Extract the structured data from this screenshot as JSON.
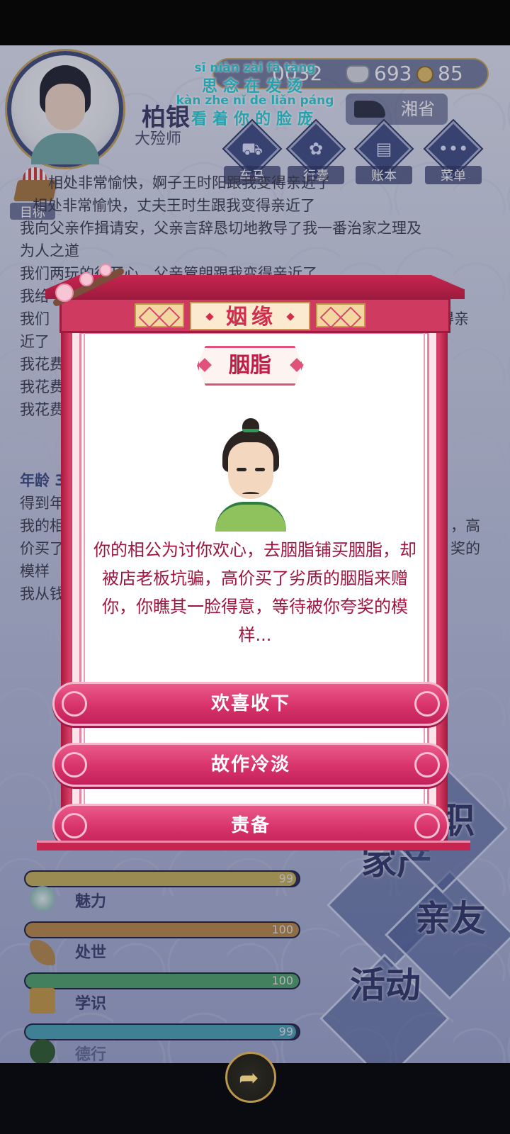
{
  "header": {
    "resources": {
      "silver_partial": "0032",
      "silver": "693",
      "gold": "85"
    },
    "lyric": {
      "pinyin_1": "sī niàn zài fā tàng",
      "line_1": "思念在发烫",
      "pinyin_2": "kàn zhe nǐ de liǎn páng",
      "line_2": "看着你的脸庞"
    },
    "player_name": "柏银",
    "player_title": "大殓师",
    "province": "湘省",
    "menu": [
      {
        "label": "车马",
        "icon": "carriage-icon",
        "glyph": "⛟"
      },
      {
        "label": "行囊",
        "icon": "bag-icon",
        "glyph": "✿"
      },
      {
        "label": "账本",
        "icon": "ledger-icon",
        "glyph": "▤"
      },
      {
        "label": "菜单",
        "icon": "more-icon",
        "glyph": "•••"
      }
    ],
    "target_label": "目标"
  },
  "log": {
    "lines_top": [
      "相处非常愉快，婀子王时阳跟我变得亲近了",
      "相处非常愉快，丈夫王时生跟我变得亲近了",
      "我向父亲作揖请安，父亲言辞恳切地教导了我一番治家之理及",
      "为人之道",
      "我们两玩的很开心，父亲管朗跟我变得亲近了",
      "我给",
      "我们",
      "近了",
      "我花费",
      "我花费",
      "我花费"
    ],
    "right_fragment_1": "得亲",
    "age_label": "年龄 3",
    "lines_bottom": [
      "得到年",
      "我的相",
      "价买了",
      "模样",
      "我从钱"
    ],
    "right_fragment_2": "，高",
    "right_fragment_3": "奖的"
  },
  "stats": [
    {
      "label": "",
      "value": 99,
      "max": 100,
      "color": "#c6b25a",
      "icon": "body-icon"
    },
    {
      "label": "魅力",
      "value": 100,
      "max": 100,
      "color": "#b88a48",
      "icon": "charm-icon"
    },
    {
      "label": "处世",
      "value": 100,
      "max": 100,
      "color": "#4ea36a",
      "icon": "worldly-icon"
    },
    {
      "label": "学识",
      "value": 99,
      "max": 100,
      "color": "#4aa3b6",
      "icon": "knowledge-icon"
    },
    {
      "label": "德行",
      "value": 100,
      "max": 100,
      "color": "#6b3a4a",
      "icon": "virtue-icon"
    }
  ],
  "side_tiles": {
    "family_property": "家产",
    "relatives": "亲友",
    "activity": "活动",
    "partial": "职"
  },
  "modal": {
    "title": "姻缘",
    "subtitle": "胭脂",
    "story": "你的相公为讨你欢心，去胭脂铺买胭脂，却被店老板坑骗，高价买了劣质的胭脂来赠你，你瞧其一脸得意，等待被你夸奖的模样...",
    "choices": [
      "欢喜收下",
      "故作冷淡",
      "责备"
    ]
  },
  "colors": {
    "accent": "#d8336b",
    "frame": "#c7254f",
    "story_text": "#a0153e"
  }
}
